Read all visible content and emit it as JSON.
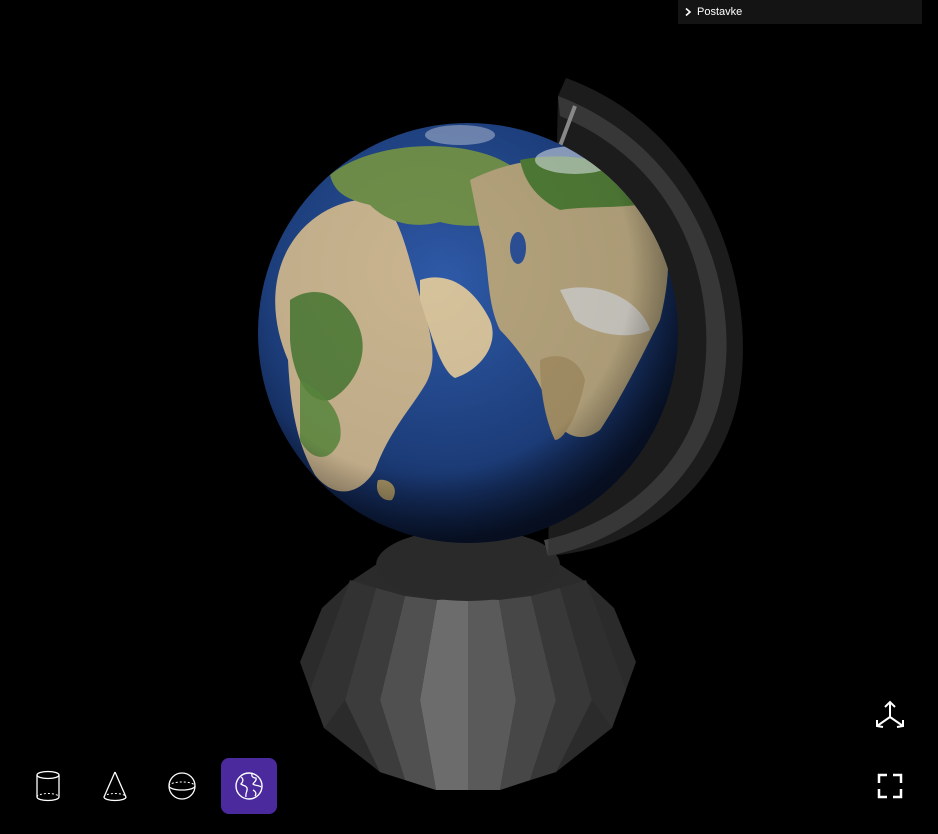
{
  "settings": {
    "label": "Postavke"
  },
  "shape_toolbar": {
    "items": [
      {
        "name": "cylinder",
        "icon": "cylinder-icon",
        "active": false
      },
      {
        "name": "cone",
        "icon": "cone-icon",
        "active": false
      },
      {
        "name": "sphere",
        "icon": "sphere-icon",
        "active": false
      },
      {
        "name": "globe",
        "icon": "globe-icon",
        "active": true
      }
    ]
  },
  "tools": {
    "axes": {
      "icon": "axes-icon"
    },
    "fullscreen": {
      "icon": "fullscreen-icon"
    }
  },
  "colors": {
    "background": "#000000",
    "active_button": "#4a2a9c",
    "ocean": "#1d3f7e",
    "land": "#c7b28e",
    "vegetation": "#4d7a36",
    "stand": "#3a3a3a"
  }
}
